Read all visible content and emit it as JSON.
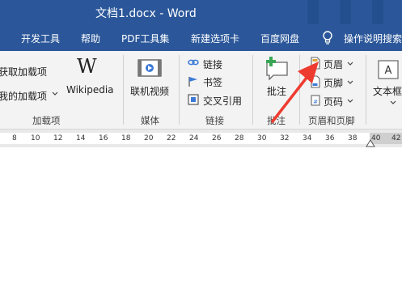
{
  "title_bar": {
    "text": "文档1.docx  -  Word"
  },
  "tabs": [
    "开发工具",
    "帮助",
    "PDF工具集",
    "新建选项卡",
    "百度网盘"
  ],
  "tell_me": "操作说明搜索",
  "ribbon": {
    "addins": {
      "get": "获取加载项",
      "mine": "我的加载项",
      "label": "加载项"
    },
    "wikipedia": "Wikipedia",
    "media": {
      "online_video": "联机视频",
      "label": "媒体"
    },
    "links": {
      "link": "链接",
      "bookmark": "书签",
      "cross_ref": "交叉引用",
      "label": "链接"
    },
    "comment": {
      "button": "批注",
      "label": "批注"
    },
    "header_footer": {
      "header": "页眉",
      "footer": "页脚",
      "page_num": "页码",
      "label": "页眉和页脚"
    },
    "text": {
      "textbox": "文本框"
    }
  },
  "ruler_ticks": [
    "8",
    "10",
    "12",
    "14",
    "16",
    "18",
    "20",
    "22",
    "24",
    "26",
    "28",
    "30",
    "32",
    "34",
    "36",
    "38",
    "40",
    "42"
  ],
  "colors": {
    "title_bar": "#2b579a",
    "ribbon_bg": "#f3f3f3",
    "arrow": "#ee3b30"
  }
}
